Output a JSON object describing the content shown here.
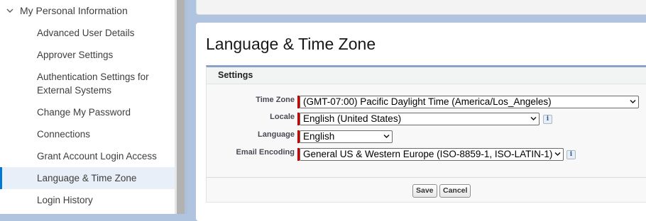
{
  "sidebar": {
    "section_label": "My Personal Information",
    "items": [
      {
        "label": "Advanced User Details"
      },
      {
        "label": "Approver Settings"
      },
      {
        "label": "Authentication Settings for External Systems"
      },
      {
        "label": "Change My Password"
      },
      {
        "label": "Connections"
      },
      {
        "label": "Grant Account Login Access"
      },
      {
        "label": "Language & Time Zone"
      },
      {
        "label": "Login History"
      }
    ]
  },
  "page": {
    "title": "Language & Time Zone"
  },
  "settings": {
    "section_title": "Settings",
    "fields": {
      "time_zone": {
        "label": "Time Zone",
        "value": "(GMT-07:00) Pacific Daylight Time (America/Los_Angeles)"
      },
      "locale": {
        "label": "Locale",
        "value": "English (United States)",
        "info": "i"
      },
      "language": {
        "label": "Language",
        "value": "English"
      },
      "email_encoding": {
        "label": "Email Encoding",
        "value": "General US & Western Europe (ISO-8859-1, ISO-LATIN-1)",
        "info": "i"
      }
    },
    "buttons": {
      "save": "Save",
      "cancel": "Cancel"
    }
  },
  "icons": {
    "section_toggle": "chevron-down-icon",
    "select_arrow": "chevron-down-icon",
    "info": "info-icon"
  },
  "colors": {
    "active_accent": "#0176d3",
    "required": "#cc0000",
    "background": "#b0c4df"
  }
}
